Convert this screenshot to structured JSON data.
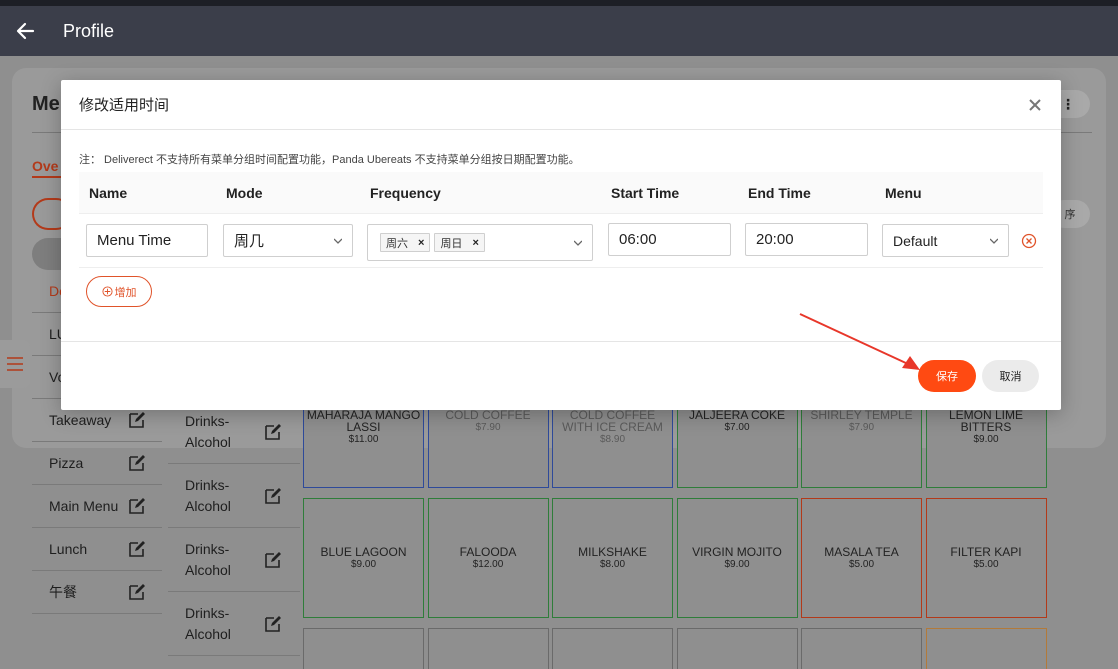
{
  "appbar": {
    "title": "Profile"
  },
  "background": {
    "heading": "Me",
    "tab_label": "Ove",
    "more_label": "⋮",
    "sort_label": "序",
    "menus": [
      {
        "label": "De",
        "active": true
      },
      {
        "label": "LU",
        "active": false
      },
      {
        "label": "Vo",
        "active": false
      },
      {
        "label": "Takeaway",
        "active": false
      },
      {
        "label": "Pizza",
        "active": false
      },
      {
        "label": "Main Menu",
        "active": false
      },
      {
        "label": "Lunch",
        "active": false
      },
      {
        "label": "午餐",
        "active": false
      }
    ],
    "categories": [
      {
        "label": "Drinks-Alcohol"
      },
      {
        "label": "Drinks-Alcohol"
      },
      {
        "label": "Drinks-Alcohol"
      },
      {
        "label": "Drinks-Alcohol"
      }
    ],
    "tiles_row1": [
      {
        "name": "MAHARAJA MANGO LASSI",
        "price": "$11.00",
        "color": "blue",
        "dim": false
      },
      {
        "name": "COLD COFFEE",
        "price": "$7.90",
        "color": "blue",
        "dim": true
      },
      {
        "name": "COLD COFFEE WITH ICE CREAM",
        "price": "$8.90",
        "color": "blue",
        "dim": true
      },
      {
        "name": "JALJEERA COKE",
        "price": "$7.00",
        "color": "green",
        "dim": false
      },
      {
        "name": "SHIRLEY TEMPLE",
        "price": "$7.90",
        "color": "green",
        "dim": true
      },
      {
        "name": "LEMON LIME BITTERS",
        "price": "$9.00",
        "color": "green",
        "dim": false
      }
    ],
    "tiles_row2": [
      {
        "name": "BLUE LAGOON",
        "price": "$9.00",
        "color": "green"
      },
      {
        "name": "FALOODA",
        "price": "$12.00",
        "color": "green"
      },
      {
        "name": "MILKSHAKE",
        "price": "$8.00",
        "color": "green"
      },
      {
        "name": "VIRGIN MOJITO",
        "price": "$9.00",
        "color": "green"
      },
      {
        "name": "MASALA TEA",
        "price": "$5.00",
        "color": "red"
      },
      {
        "name": "FILTER KAPI",
        "price": "$5.00",
        "color": "red"
      }
    ]
  },
  "modal": {
    "title": "修改适用时间",
    "note": "注： Deliverect 不支持所有菜单分组时间配置功能，Panda Ubereats 不支持菜单分组按日期配置功能。",
    "columns": [
      "Name",
      "Mode",
      "Frequency",
      "Start Time",
      "End Time",
      "Menu"
    ],
    "row": {
      "name": "Menu Time",
      "mode": "周几",
      "frequency_tags": [
        "周六",
        "周日"
      ],
      "start_time": "06:00",
      "end_time": "20:00",
      "menu": "Default"
    },
    "add_label": "增加",
    "save_label": "保存",
    "cancel_label": "取消"
  },
  "colors": {
    "accent": "#ff4a12",
    "appbar": "#3b3e4a",
    "annotation_arrow": "#e8372a"
  }
}
